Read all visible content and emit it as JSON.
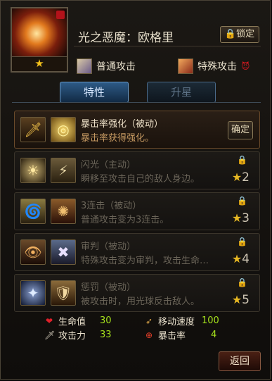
{
  "hero": {
    "name": "光之恶魔：欧格里",
    "portrait_star": "★",
    "lock_button": "🔒锁定"
  },
  "attacks": {
    "normal": "普通攻击",
    "special": "特殊攻击"
  },
  "tabs": [
    {
      "label": "特性",
      "active": true
    },
    {
      "label": "升星",
      "active": false
    }
  ],
  "skills": [
    {
      "title": "暴击率强化（被动）",
      "desc": "暴击率获得强化。",
      "button": "确定",
      "unlocked": true
    },
    {
      "title": "闪光（主动）",
      "desc": "瞬移至攻击自己的敌人身边。",
      "stars": "2",
      "unlocked": false
    },
    {
      "title": "3连击（被动）",
      "desc": "普通攻击变为3连击。",
      "stars": "3",
      "unlocked": false
    },
    {
      "title": "审判（被动）",
      "desc": "特殊攻击变为审判，攻击生命…",
      "stars": "4",
      "unlocked": false
    },
    {
      "title": "惩罚（被动）",
      "desc": "被攻击时，用光球反击敌人。",
      "stars": "5",
      "unlocked": false
    }
  ],
  "stats": [
    {
      "label": "生命值",
      "value": "30",
      "icon": "heart-icon"
    },
    {
      "label": "移动速度",
      "value": "100",
      "icon": "boot-icon"
    },
    {
      "label": "攻击力",
      "value": "33",
      "icon": "sword-icon"
    },
    {
      "label": "暴击率",
      "value": "4",
      "icon": "crosshair-icon"
    }
  ],
  "back_button": "返回"
}
